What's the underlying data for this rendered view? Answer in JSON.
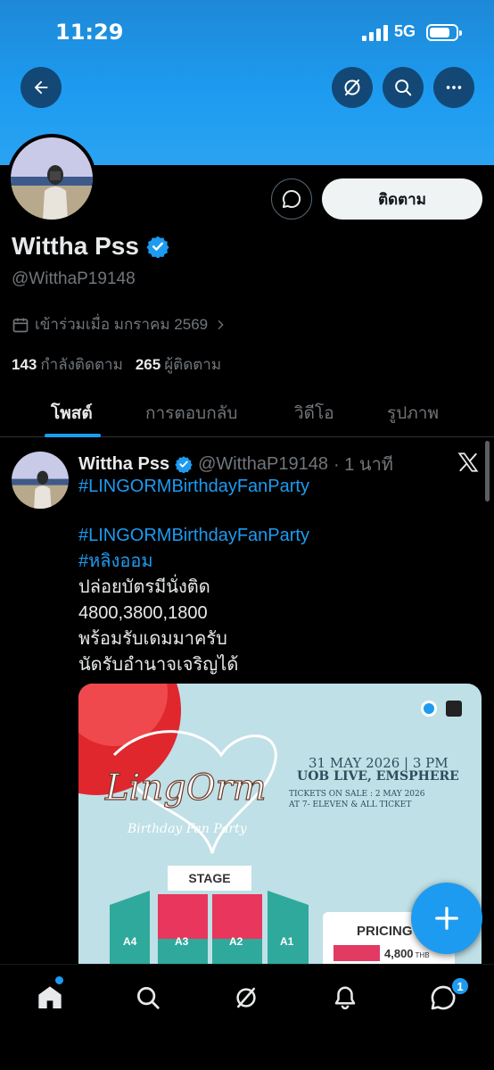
{
  "status_bar": {
    "time": "11:29",
    "network": "5G"
  },
  "profile": {
    "display_name": "Wittha Pss",
    "handle": "@WitthaP19148",
    "joined": "เข้าร่วมเมื่อ มกราคม 2569",
    "following_count": "143",
    "following_label": "กำลังติดตาม",
    "followers_count": "265",
    "followers_label": "ผู้ติดตาม",
    "follow_label": "ติดตาม"
  },
  "tabs": [
    "โพสต์",
    "การตอบกลับ",
    "วิดีโอ",
    "รูปภาพ"
  ],
  "post": {
    "name": "Wittha Pss",
    "handle": "@WitthaP19148",
    "time": "· 1 นาที",
    "lines": [
      {
        "text": "#LINGORMBirthdayFanParty",
        "type": "hashtag"
      },
      {
        "text": "#LINGORMBirthdayFanParty",
        "type": "hashtag"
      },
      {
        "text": "#หลิงออม",
        "type": "hashtag"
      },
      {
        "text": "ปล่อยบัตรมีนั่งติด",
        "type": "text"
      },
      {
        "text": "4800,3800,1800",
        "type": "text"
      },
      {
        "text": "พร้อมรับเดมมาครับ",
        "type": "text"
      },
      {
        "text": "นัดรับอำนาจเจริญได้",
        "type": "text"
      }
    ],
    "media": {
      "date": "31 MAY 2026 | 3 PM",
      "venue": "UOB LIVE, EMSPHERE",
      "sale_line1": "TICKETS ON SALE : 2 MAY 2026",
      "sale_line2": "AT 7- ELEVEN & ALL TICKET",
      "stage": "STAGE",
      "zones": [
        "A4",
        "A3",
        "A2",
        "A1"
      ],
      "pricing_title": "PRICING",
      "price": "4,800",
      "currency": "THB"
    }
  },
  "icons": {
    "back": "arrow-left-icon",
    "grok": "grok-icon",
    "search": "search-icon",
    "more": "more-icon",
    "message": "message-bubble-icon",
    "verified": "verified-badge-icon",
    "calendar": "calendar-icon",
    "x_logo": "x-logo-icon",
    "compose": "plus-icon"
  },
  "bottom_nav": {
    "messages_badge": "1"
  },
  "colors": {
    "accent": "#1d9bf0",
    "background": "#000000",
    "text": "#e7e9ea",
    "muted": "#71767b"
  }
}
